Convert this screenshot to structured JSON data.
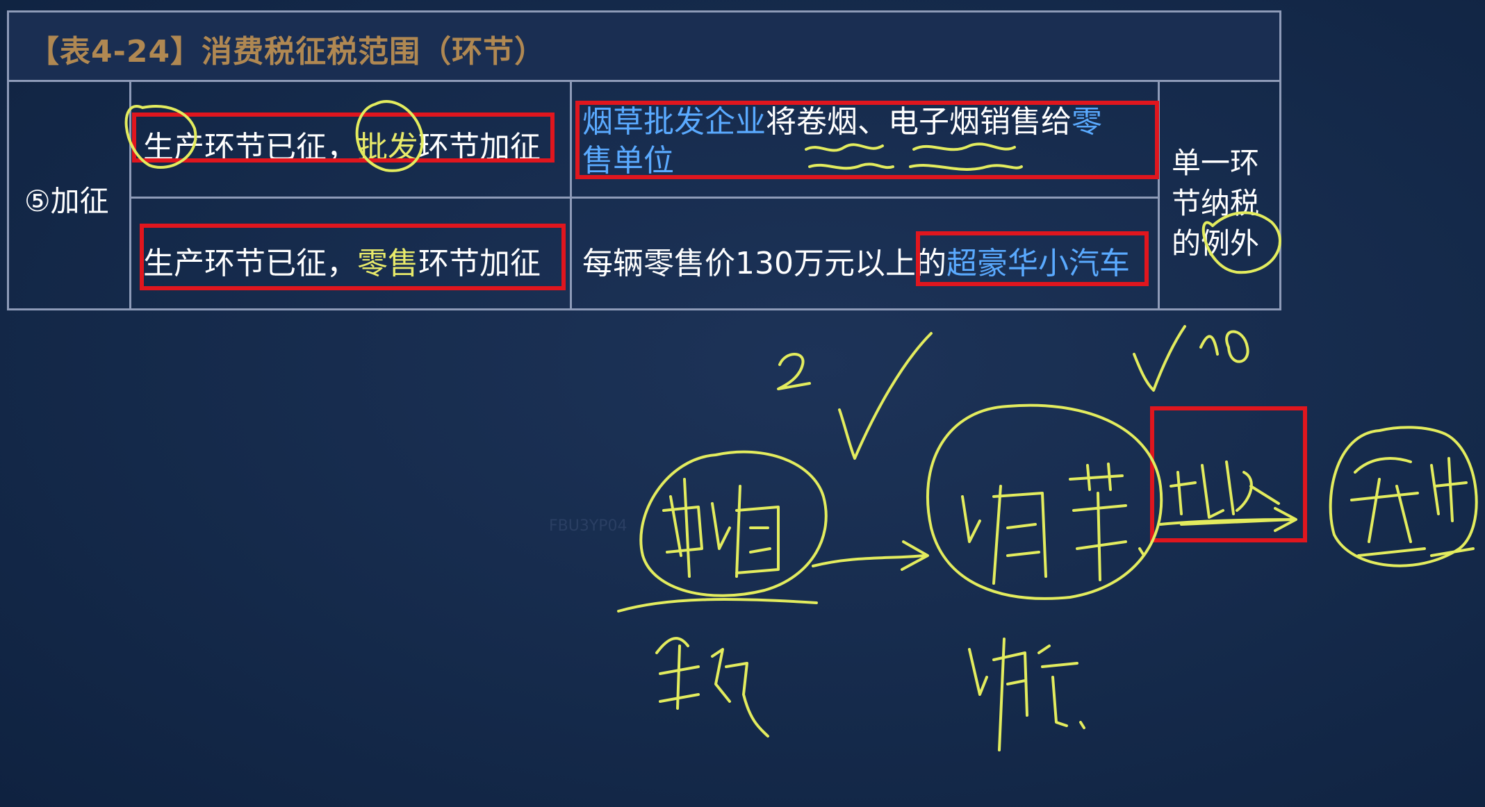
{
  "table": {
    "title": "【表4-24】消费税征税范围（环节）",
    "category": "⑤加征",
    "rows": [
      {
        "stage_part1": "生产环节已征，",
        "stage_highlight": "批发",
        "stage_part2": "环节加征",
        "desc_blue1": "烟草批发企业",
        "desc_white": "将卷烟、电子烟销售给",
        "desc_blue2": "零",
        "desc_blue3": "售单位"
      },
      {
        "stage_part1": "生产环节已征，",
        "stage_highlight": "零售",
        "stage_part2": "环节加征",
        "desc_white": "每辆零售价130万元以上的",
        "desc_blue1": "超豪华小汽车"
      }
    ],
    "note_lines": [
      "单一环",
      "节纳税",
      "的例外"
    ]
  },
  "watermark": "FBU3YP04",
  "colors": {
    "background": "#152a4b",
    "highlight_yellow": "#e8ea6a",
    "highlight_blue": "#5aaaff",
    "annotation_red": "#e0161e",
    "handwriting": "#e3ec5e"
  }
}
